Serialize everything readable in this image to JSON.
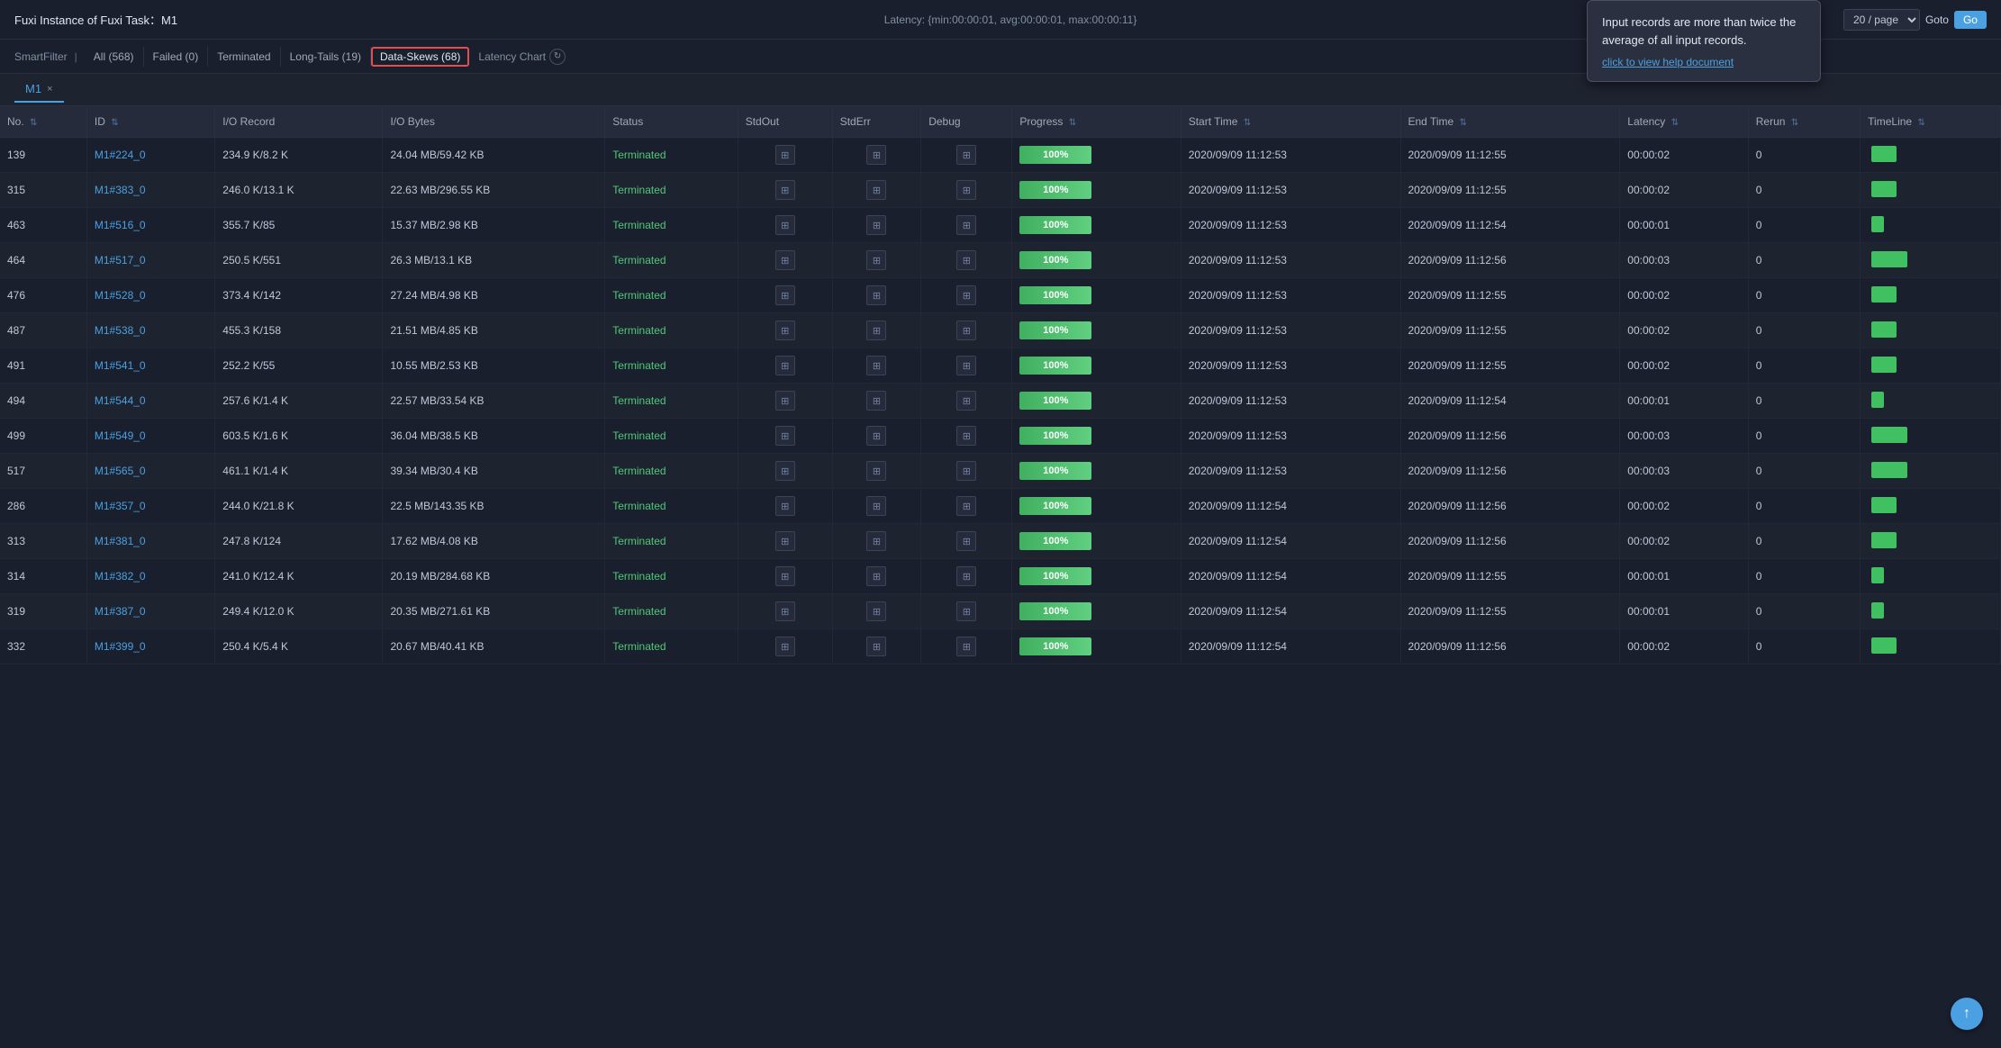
{
  "header": {
    "task_label": "Fuxi Instance of Fuxi Task：",
    "task_name": "M1",
    "latency_info": "Latency: {min:00:00:01, avg:00:00:01, max:00:00:11}"
  },
  "pagination": {
    "per_page": "20 / page",
    "goto_label": "Goto"
  },
  "tooltip": {
    "text": "Input records are more than twice the average of all input records.",
    "link_text": "click to view help document"
  },
  "filter": {
    "label": "SmartFilter",
    "items": [
      {
        "id": "all",
        "label": "All",
        "count": "568"
      },
      {
        "id": "failed",
        "label": "Failed",
        "count": "0"
      },
      {
        "id": "terminated",
        "label": "Terminated",
        "count": ""
      },
      {
        "id": "long-tails",
        "label": "Long-Tails",
        "count": "19"
      },
      {
        "id": "data-skews",
        "label": "Data-Skews",
        "count": "68"
      }
    ],
    "latency_chart": "Latency Chart"
  },
  "tab": {
    "label": "M1",
    "close": "×"
  },
  "columns": [
    "No.",
    "ID",
    "I/O Record",
    "I/O Bytes",
    "Status",
    "StdOut",
    "StdErr",
    "Debug",
    "Progress",
    "Start Time",
    "End Time",
    "Latency",
    "Rerun",
    "TimeLine"
  ],
  "rows": [
    {
      "no": "139",
      "id": "M1#224_0",
      "io_record": "234.9 K/8.2 K",
      "io_bytes": "24.04 MB/59.42 KB",
      "status": "Terminated",
      "progress": 100,
      "start_time": "2020/09/09 11:12:53",
      "end_time": "2020/09/09 11:12:55",
      "latency": "00:00:02",
      "rerun": "0",
      "timeline_width": 28
    },
    {
      "no": "315",
      "id": "M1#383_0",
      "io_record": "246.0 K/13.1 K",
      "io_bytes": "22.63 MB/296.55 KB",
      "status": "Terminated",
      "progress": 100,
      "start_time": "2020/09/09 11:12:53",
      "end_time": "2020/09/09 11:12:55",
      "latency": "00:00:02",
      "rerun": "0",
      "timeline_width": 28
    },
    {
      "no": "463",
      "id": "M1#516_0",
      "io_record": "355.7 K/85",
      "io_bytes": "15.37 MB/2.98 KB",
      "status": "Terminated",
      "progress": 100,
      "start_time": "2020/09/09 11:12:53",
      "end_time": "2020/09/09 11:12:54",
      "latency": "00:00:01",
      "rerun": "0",
      "timeline_width": 14
    },
    {
      "no": "464",
      "id": "M1#517_0",
      "io_record": "250.5 K/551",
      "io_bytes": "26.3 MB/13.1 KB",
      "status": "Terminated",
      "progress": 100,
      "start_time": "2020/09/09 11:12:53",
      "end_time": "2020/09/09 11:12:56",
      "latency": "00:00:03",
      "rerun": "0",
      "timeline_width": 40
    },
    {
      "no": "476",
      "id": "M1#528_0",
      "io_record": "373.4 K/142",
      "io_bytes": "27.24 MB/4.98 KB",
      "status": "Terminated",
      "progress": 100,
      "start_time": "2020/09/09 11:12:53",
      "end_time": "2020/09/09 11:12:55",
      "latency": "00:00:02",
      "rerun": "0",
      "timeline_width": 28
    },
    {
      "no": "487",
      "id": "M1#538_0",
      "io_record": "455.3 K/158",
      "io_bytes": "21.51 MB/4.85 KB",
      "status": "Terminated",
      "progress": 100,
      "start_time": "2020/09/09 11:12:53",
      "end_time": "2020/09/09 11:12:55",
      "latency": "00:00:02",
      "rerun": "0",
      "timeline_width": 28
    },
    {
      "no": "491",
      "id": "M1#541_0",
      "io_record": "252.2 K/55",
      "io_bytes": "10.55 MB/2.53 KB",
      "status": "Terminated",
      "progress": 100,
      "start_time": "2020/09/09 11:12:53",
      "end_time": "2020/09/09 11:12:55",
      "latency": "00:00:02",
      "rerun": "0",
      "timeline_width": 28
    },
    {
      "no": "494",
      "id": "M1#544_0",
      "io_record": "257.6 K/1.4 K",
      "io_bytes": "22.57 MB/33.54 KB",
      "status": "Terminated",
      "progress": 100,
      "start_time": "2020/09/09 11:12:53",
      "end_time": "2020/09/09 11:12:54",
      "latency": "00:00:01",
      "rerun": "0",
      "timeline_width": 14
    },
    {
      "no": "499",
      "id": "M1#549_0",
      "io_record": "603.5 K/1.6 K",
      "io_bytes": "36.04 MB/38.5 KB",
      "status": "Terminated",
      "progress": 100,
      "start_time": "2020/09/09 11:12:53",
      "end_time": "2020/09/09 11:12:56",
      "latency": "00:00:03",
      "rerun": "0",
      "timeline_width": 40
    },
    {
      "no": "517",
      "id": "M1#565_0",
      "io_record": "461.1 K/1.4 K",
      "io_bytes": "39.34 MB/30.4 KB",
      "status": "Terminated",
      "progress": 100,
      "start_time": "2020/09/09 11:12:53",
      "end_time": "2020/09/09 11:12:56",
      "latency": "00:00:03",
      "rerun": "0",
      "timeline_width": 40
    },
    {
      "no": "286",
      "id": "M1#357_0",
      "io_record": "244.0 K/21.8 K",
      "io_bytes": "22.5 MB/143.35 KB",
      "status": "Terminated",
      "progress": 100,
      "start_time": "2020/09/09 11:12:54",
      "end_time": "2020/09/09 11:12:56",
      "latency": "00:00:02",
      "rerun": "0",
      "timeline_width": 28
    },
    {
      "no": "313",
      "id": "M1#381_0",
      "io_record": "247.8 K/124",
      "io_bytes": "17.62 MB/4.08 KB",
      "status": "Terminated",
      "progress": 100,
      "start_time": "2020/09/09 11:12:54",
      "end_time": "2020/09/09 11:12:56",
      "latency": "00:00:02",
      "rerun": "0",
      "timeline_width": 28
    },
    {
      "no": "314",
      "id": "M1#382_0",
      "io_record": "241.0 K/12.4 K",
      "io_bytes": "20.19 MB/284.68 KB",
      "status": "Terminated",
      "progress": 100,
      "start_time": "2020/09/09 11:12:54",
      "end_time": "2020/09/09 11:12:55",
      "latency": "00:00:01",
      "rerun": "0",
      "timeline_width": 14
    },
    {
      "no": "319",
      "id": "M1#387_0",
      "io_record": "249.4 K/12.0 K",
      "io_bytes": "20.35 MB/271.61 KB",
      "status": "Terminated",
      "progress": 100,
      "start_time": "2020/09/09 11:12:54",
      "end_time": "2020/09/09 11:12:55",
      "latency": "00:00:01",
      "rerun": "0",
      "timeline_width": 14
    },
    {
      "no": "332",
      "id": "M1#399_0",
      "io_record": "250.4 K/5.4 K",
      "io_bytes": "20.67 MB/40.41 KB",
      "status": "Terminated",
      "progress": 100,
      "start_time": "2020/09/09 11:12:54",
      "end_time": "2020/09/09 11:12:56",
      "latency": "00:00:02",
      "rerun": "0",
      "timeline_width": 28
    }
  ]
}
